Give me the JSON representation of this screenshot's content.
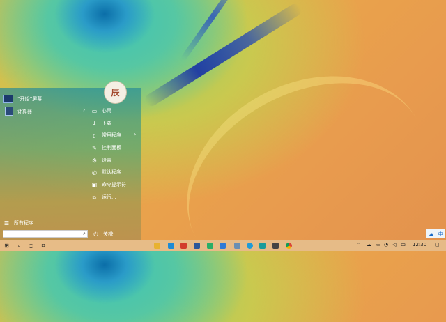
{
  "start_menu": {
    "pinned_title": "“开始”屏幕",
    "app_calculator": "计算器",
    "all_programs": "所有程序",
    "search_placeholder": "",
    "right_items": [
      {
        "label": "心雨"
      },
      {
        "label": "下载"
      },
      {
        "label": "常用程序"
      },
      {
        "label": "控制面板"
      },
      {
        "label": "设置"
      },
      {
        "label": "默认程序"
      },
      {
        "label": "命令提示符"
      },
      {
        "label": "运行..."
      }
    ],
    "shutdown": "关机"
  },
  "avatar": {
    "text": "辰"
  },
  "taskbar": {
    "clock": "12:30"
  },
  "ime": {
    "label": "中"
  }
}
